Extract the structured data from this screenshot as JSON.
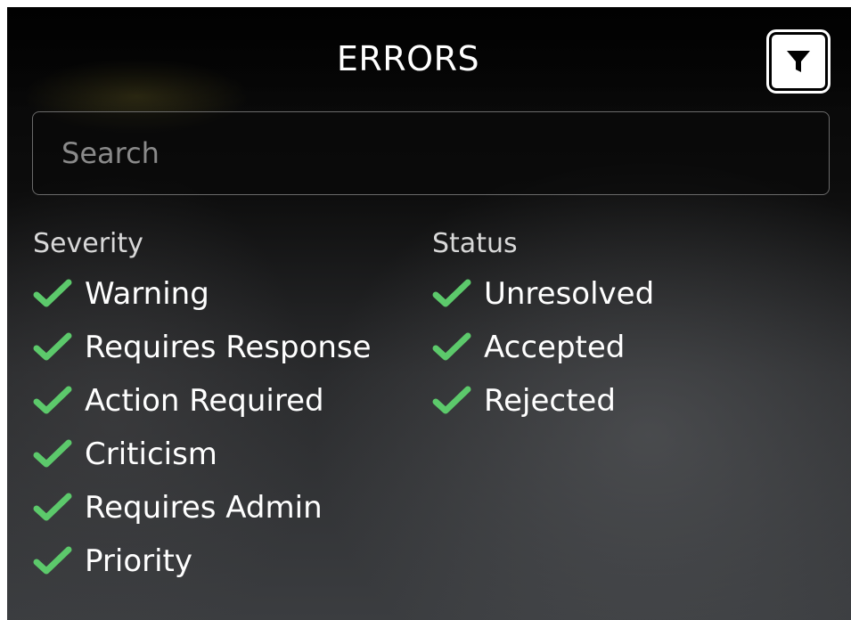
{
  "header": {
    "title": "ERRORS",
    "filter_icon": "filter-funnel-icon"
  },
  "search": {
    "placeholder": "Search",
    "value": ""
  },
  "severity": {
    "label": "Severity",
    "options": [
      {
        "label": "Warning",
        "checked": true
      },
      {
        "label": "Requires Response",
        "checked": true
      },
      {
        "label": "Action Required",
        "checked": true
      },
      {
        "label": "Criticism",
        "checked": true
      },
      {
        "label": "Requires Admin",
        "checked": true
      },
      {
        "label": "Priority",
        "checked": true
      }
    ]
  },
  "status": {
    "label": "Status",
    "options": [
      {
        "label": "Unresolved",
        "checked": true
      },
      {
        "label": "Accepted",
        "checked": true
      },
      {
        "label": "Rejected",
        "checked": true
      }
    ]
  },
  "colors": {
    "check": "#5cc96b",
    "text": "#ffffff",
    "muted_text": "#d8d8d8",
    "placeholder": "#8a8a8a",
    "search_border": "#6a6a6a"
  }
}
